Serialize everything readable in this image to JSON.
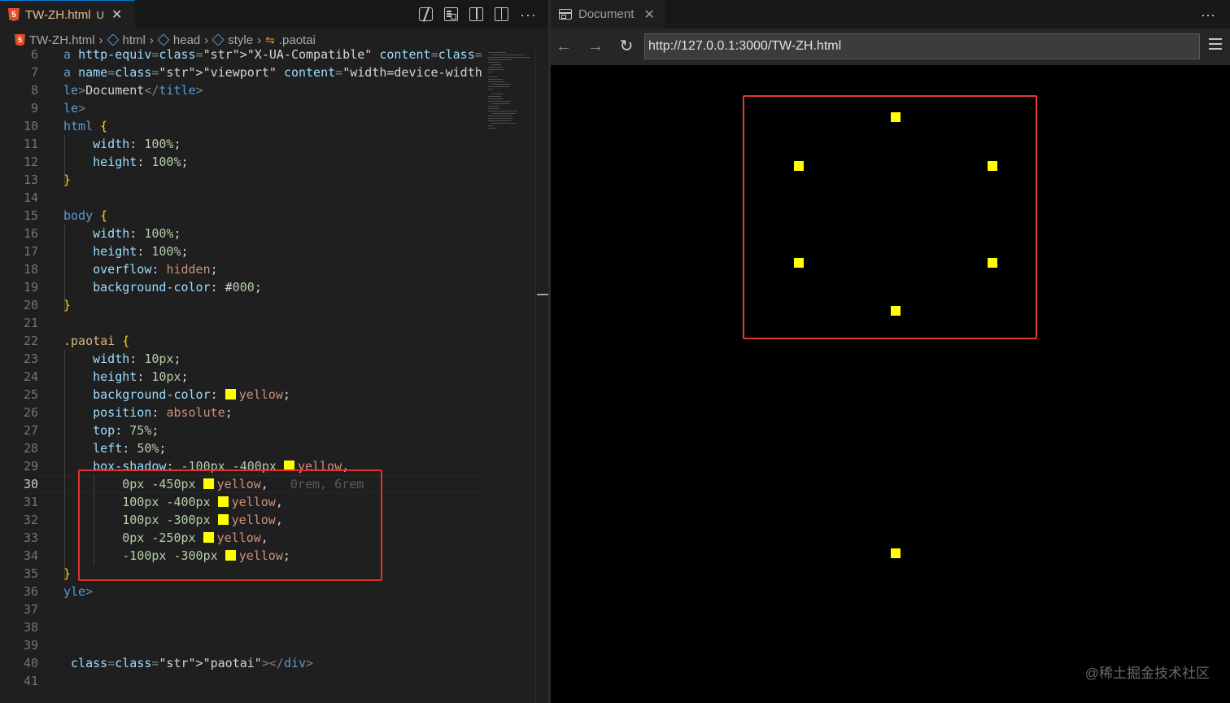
{
  "editor": {
    "tab": {
      "filename": "TW-ZH.html",
      "status": "U",
      "icon": "html5-icon"
    },
    "actions": [
      "open-changes-icon",
      "preview-icon",
      "toggle-layout-icon",
      "split-editor-icon",
      "more-icon"
    ],
    "breadcrumb": [
      {
        "label": "TW-ZH.html",
        "icon": "html5-icon"
      },
      {
        "label": "html",
        "icon": "cube-icon"
      },
      {
        "label": "head",
        "icon": "cube-icon"
      },
      {
        "label": "style",
        "icon": "cube-icon"
      },
      {
        "label": ".paotai",
        "icon": "class-symbol-icon"
      }
    ],
    "current_line": 30,
    "lines": [
      {
        "n": "6",
        "text": "a http-equiv=\"X-UA-Compatible\" content=\"IE=edge\">"
      },
      {
        "n": "7",
        "text": "a name=\"viewport\" content=\"width=device-width, initial-s"
      },
      {
        "n": "8",
        "text": "le>Document</title>"
      },
      {
        "n": "9",
        "text": "le>"
      },
      {
        "n": "10",
        "text": "html {"
      },
      {
        "n": "11",
        "text": "    width: 100%;"
      },
      {
        "n": "12",
        "text": "    height: 100%;"
      },
      {
        "n": "13",
        "text": "}"
      },
      {
        "n": "14",
        "text": ""
      },
      {
        "n": "15",
        "text": "body {"
      },
      {
        "n": "16",
        "text": "    width: 100%;"
      },
      {
        "n": "17",
        "text": "    height: 100%;"
      },
      {
        "n": "18",
        "text": "    overflow: hidden;"
      },
      {
        "n": "19",
        "text": "    background-color: #000;"
      },
      {
        "n": "20",
        "text": "}"
      },
      {
        "n": "21",
        "text": ""
      },
      {
        "n": "22",
        "text": ".paotai {"
      },
      {
        "n": "23",
        "text": "    width: 10px;"
      },
      {
        "n": "24",
        "text": "    height: 10px;"
      },
      {
        "n": "25",
        "text": "    background-color: yellow;"
      },
      {
        "n": "26",
        "text": "    position: absolute;"
      },
      {
        "n": "27",
        "text": "    top: 75%;"
      },
      {
        "n": "28",
        "text": "    left: 50%;"
      },
      {
        "n": "29",
        "text": "    box-shadow: -100px -400px yellow,"
      },
      {
        "n": "30",
        "text": "        0px -450px yellow,",
        "hint": "0rem, 6rem"
      },
      {
        "n": "31",
        "text": "        100px -400px yellow,"
      },
      {
        "n": "32",
        "text": "        100px -300px yellow,"
      },
      {
        "n": "33",
        "text": "        0px -250px yellow,"
      },
      {
        "n": "34",
        "text": "        -100px -300px yellow;"
      },
      {
        "n": "35",
        "text": "}"
      },
      {
        "n": "36",
        "text": "yle>"
      },
      {
        "n": "37",
        "text": ""
      },
      {
        "n": "38",
        "text": ""
      },
      {
        "n": "39",
        "text": ""
      },
      {
        "n": "40",
        "text": " class=\"paotai\"></div>"
      },
      {
        "n": "41",
        "text": ""
      }
    ]
  },
  "browser": {
    "tab": {
      "title": "Document",
      "icon": "browser-icon"
    },
    "url": "http://127.0.0.1:3000/TW-ZH.html",
    "nav": {
      "back": "←",
      "forward": "→",
      "reload": "↻"
    },
    "viewport_background": "#000000",
    "shape_color": "#ffff00",
    "annotation_color": "#e53935",
    "watermark": "@稀土掘金技术社区"
  }
}
